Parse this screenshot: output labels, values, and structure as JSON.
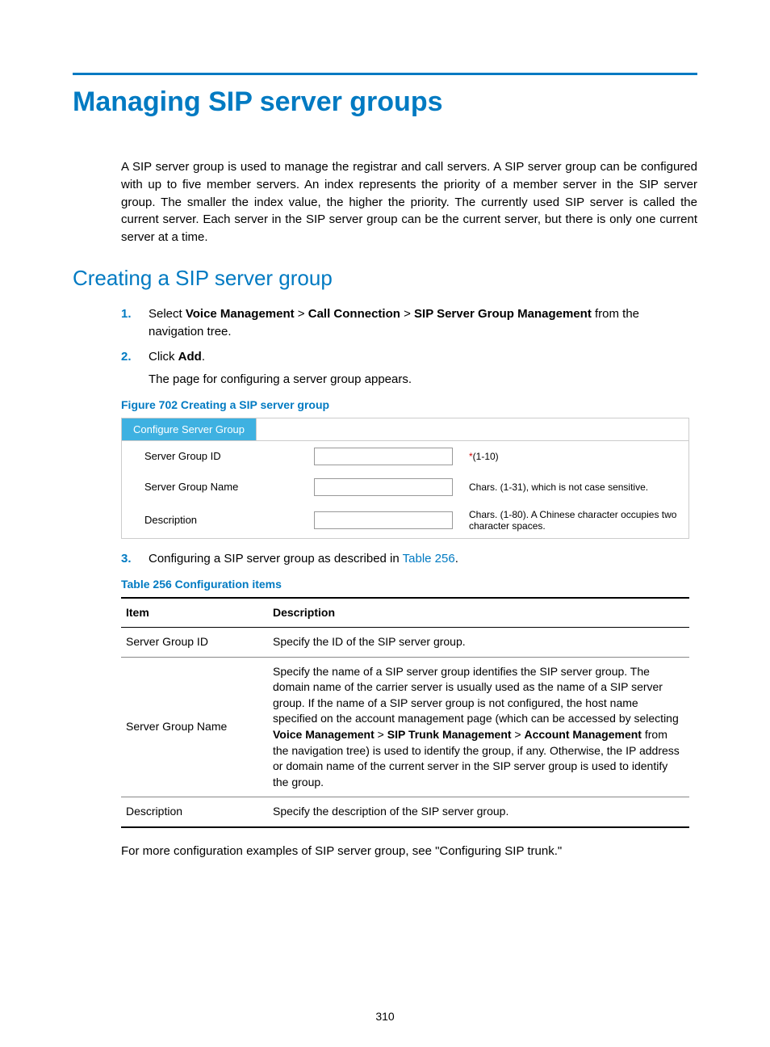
{
  "title": "Managing SIP server groups",
  "intro": "A SIP server group is used to manage the registrar and call servers. A SIP server group can be configured with up to five member servers. An index represents the priority of a member server in the SIP server group. The smaller the index value, the higher the priority. The currently used SIP server is called the current server. Each server in the SIP server group can be the current server, but there is only one current server at a time.",
  "section1": "Creating a SIP server group",
  "steps": {
    "n1": "1.",
    "s1a": "Select ",
    "s1_vm": "Voice Management",
    "gt": " > ",
    "s1_cc": "Call Connection",
    "s1_sgm": "SIP Server Group Management",
    "s1b": " from the navigation tree.",
    "n2": "2.",
    "s2a": "Click ",
    "s2_add": "Add",
    "s2b": ".",
    "s2_sub": "The page for configuring a server group appears.",
    "n3": "3.",
    "s3a": "Configuring a SIP server group as described in ",
    "s3_link": "Table 256",
    "s3b": "."
  },
  "figure": {
    "caption": "Figure 702 Creating a SIP server group",
    "tab": "Configure Server Group",
    "rows": [
      {
        "label": "Server Group ID",
        "hint_star": "*",
        "hint": "(1-10)"
      },
      {
        "label": "Server Group Name",
        "hint_star": "",
        "hint": "Chars. (1-31), which is not case sensitive."
      },
      {
        "label": "Description",
        "hint_star": "",
        "hint": "Chars. (1-80). A Chinese character occupies two character spaces."
      }
    ]
  },
  "table": {
    "caption": "Table 256 Configuration items",
    "head_item": "Item",
    "head_desc": "Description",
    "rows": [
      {
        "item": "Server Group ID",
        "desc_pre": "Specify the ID of the SIP server group."
      },
      {
        "item": "Server Group Name",
        "desc_pre": "Specify the name of a SIP server group identifies the SIP server group. The domain name of the carrier server is usually used as the name of a SIP server group. If the name of a SIP server group is not configured, the host name specified on the account management page (which can be accessed by selecting ",
        "b1": "Voice Management",
        "gt": " > ",
        "b2": "SIP Trunk Management",
        "b3": "Account Management",
        "desc_post": " from the navigation tree) is used to identify the group, if any. Otherwise, the IP address or domain name of the current server in the SIP server group is used to identify the group."
      },
      {
        "item": "Description",
        "desc_pre": "Specify the description of the SIP server group."
      }
    ]
  },
  "after_table": "For more configuration examples of SIP server group, see \"Configuring SIP trunk.\"",
  "page_num": "310"
}
